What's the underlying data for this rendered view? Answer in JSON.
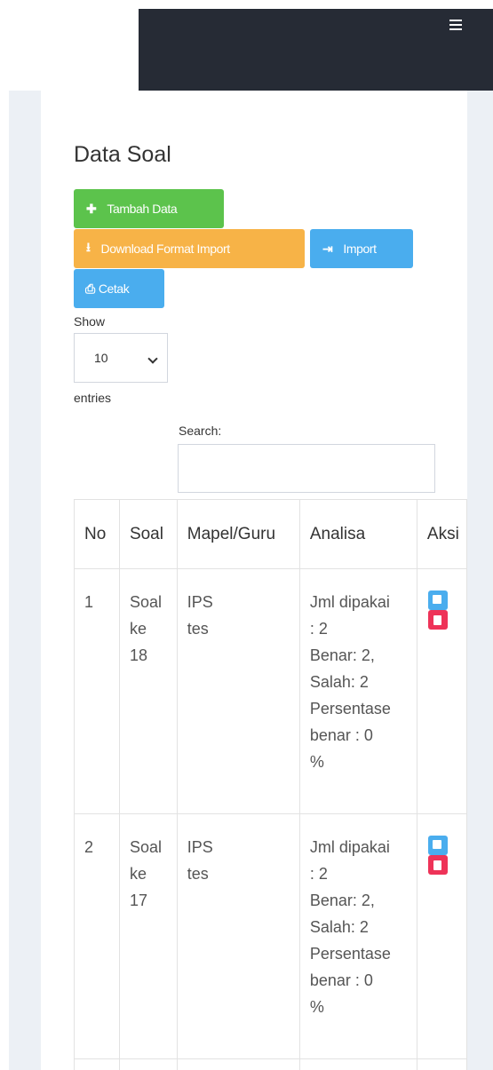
{
  "navbar": {
    "menu_icon": "hamburger-menu-icon"
  },
  "page": {
    "title": "Data Soal"
  },
  "toolbar": {
    "add_label": "Tambah Data",
    "download_label": "Download Format Import",
    "import_label": "Import",
    "print_label": "Cetak"
  },
  "entries": {
    "show_label": "Show",
    "selected": "10",
    "entries_label": "entries"
  },
  "search": {
    "label": "Search:",
    "value": ""
  },
  "table": {
    "headers": [
      "No",
      "Soal",
      "Mapel/Guru",
      "Analisa",
      "Aksi"
    ],
    "rows": [
      {
        "no": "1",
        "soal": [
          "Soal",
          "ke",
          "18"
        ],
        "mapel": [
          "IPS",
          "tes"
        ],
        "analisa": [
          "Jml dipakai",
          ": 2",
          "Benar: 2,",
          "Salah: 2",
          "Persentase",
          "benar : 0",
          "%"
        ]
      },
      {
        "no": "2",
        "soal": [
          "Soal",
          "ke",
          "17"
        ],
        "mapel": [
          "IPS",
          "tes"
        ],
        "analisa": [
          "Jml dipakai",
          ": 2",
          "Benar: 2,",
          "Salah: 2",
          "Persentase",
          "benar : 0",
          "%"
        ]
      }
    ]
  },
  "colors": {
    "navbar": "#262b35",
    "green": "#5cc34c",
    "orange": "#f7b347",
    "blue": "#4aadee",
    "red": "#ee3358"
  }
}
